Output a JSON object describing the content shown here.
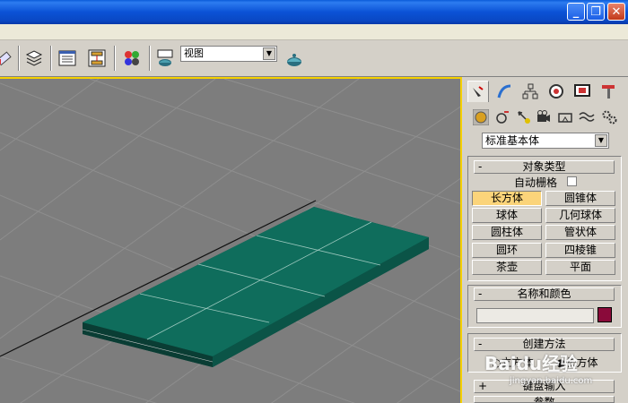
{
  "window": {
    "minimize": "_",
    "restore": "❐",
    "close": "✕"
  },
  "toolbar": {
    "view_select": "视图"
  },
  "panel": {
    "category_select": "标准基本体",
    "rollouts": {
      "object_type": {
        "sign": "-",
        "title": "对象类型",
        "auto_grid": "自动栅格",
        "buttons": [
          "长方体",
          "圆锥体",
          "球体",
          "几何球体",
          "圆柱体",
          "管状体",
          "圆环",
          "四棱锥",
          "茶壶",
          "平面"
        ],
        "active": "长方体"
      },
      "name_color": {
        "sign": "-",
        "title": "名称和颜色",
        "name_value": "",
        "color": "#8a0a3a"
      },
      "creation_method": {
        "sign": "-",
        "title": "创建方法",
        "opt1": "立方体",
        "opt2": "长方体"
      },
      "keyboard_input": {
        "sign": "+",
        "title": "键盘输入"
      },
      "params": {
        "title": "参数"
      }
    }
  },
  "watermark": {
    "brand": "Baidu经验",
    "url": "jingyan.baidu.com"
  },
  "colors": {
    "box_top": "#0f6d5c",
    "box_side": "#0a4a3f",
    "grid": "#8e8e8e",
    "active_border": "#f5d000"
  }
}
